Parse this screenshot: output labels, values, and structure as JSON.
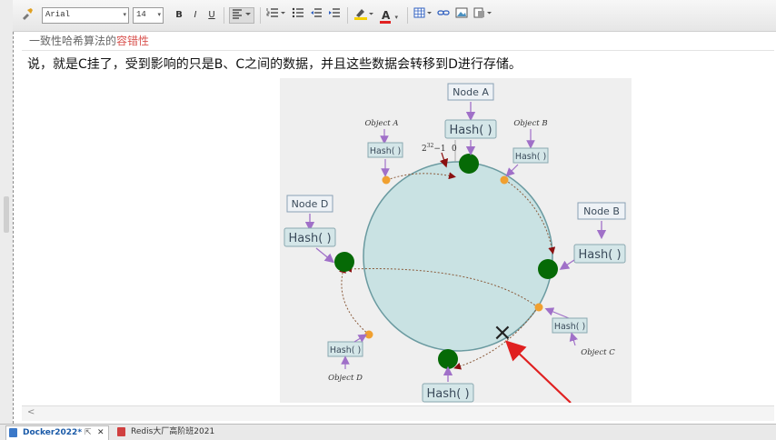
{
  "toolbar": {
    "font_name": "Arial",
    "font_size": "14",
    "bold": "B",
    "italic": "I",
    "underline": "U",
    "font_color_glyph": "A",
    "dropdown_glyph": "▾"
  },
  "note": {
    "title_prefix": "一致性哈希算法的",
    "title_highlight": "容错性",
    "body": "说，就是C挂了，受到影响的只是B、C之间的数据，并且这些数据会转移到D进行存储。"
  },
  "diagram": {
    "labels": {
      "node_a": "Node A",
      "node_b": "Node B",
      "node_d": "Node D",
      "hash_big": "Hash( )",
      "hash_small": "Hash( )",
      "object_a": "Object A",
      "object_b": "Object B",
      "object_c": "Object C",
      "object_d": "Object D",
      "ring_max": "2",
      "ring_max_exp": "32",
      "ring_max_tail": "−1",
      "ring_zero": "0",
      "failed_marker": "×"
    },
    "colors": {
      "ring_fill": "#c9e2e3",
      "node_dot": "#066a06",
      "object_dot": "#f0a030",
      "arrow_purple": "#a070c8",
      "arrow_red": "#e02020",
      "path": "#8a5a3a"
    }
  },
  "tabs": [
    {
      "label": "Docker2022*",
      "active": true,
      "pin": "⇱",
      "close": "✕"
    },
    {
      "label": "Redis大厂高阶班2021",
      "active": false
    }
  ],
  "scroll_left_glyph": "<"
}
